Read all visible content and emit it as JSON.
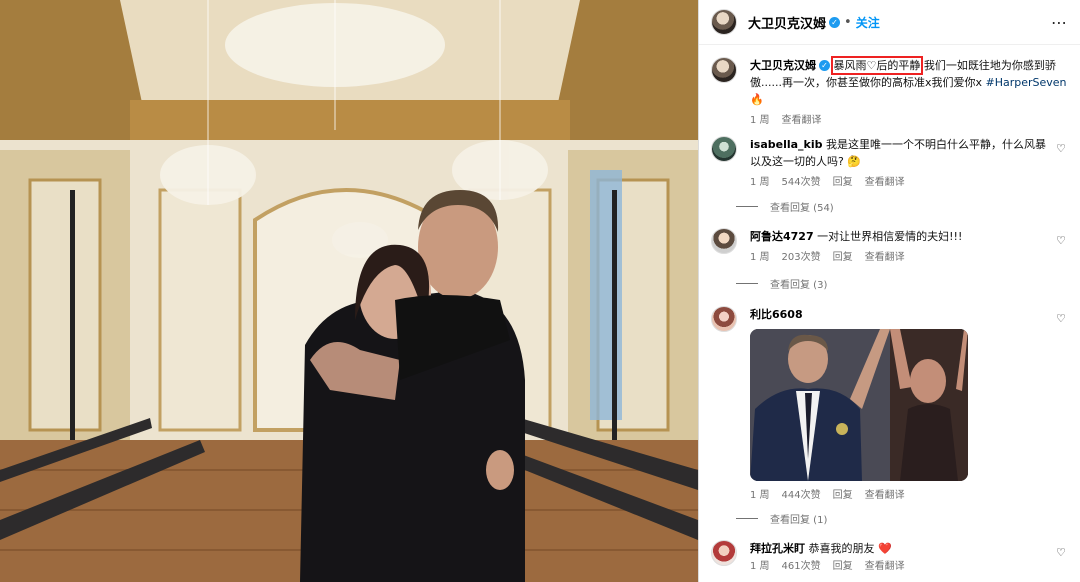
{
  "header": {
    "username": "大卫贝克汉姆",
    "dot": "•",
    "follow_label": "关注",
    "more_label": "⋯"
  },
  "caption": {
    "username": "大卫贝克汉姆",
    "text_highlight": "暴风雨♡后的平静",
    "text_rest": "  我们一如既往地为你感到骄傲......再一次，你甚至做你的高标准x我们爱你x ",
    "hashtag": "#HarperSeven",
    "emoji": "🔥",
    "time": "1 周",
    "translate": "查看翻译"
  },
  "comments": [
    {
      "username": "isabella_kib",
      "text": "我是这里唯一一个不明白什么平静，什么风暴以及这一切的人吗? 🤔",
      "time": "1 周",
      "likes": "544次赞",
      "reply": "回复",
      "translate": "查看翻译",
      "view_replies": "查看回复 (54)"
    },
    {
      "username": "阿鲁达4727",
      "text": "一对让世界相信爱情的夫妇!!!",
      "time": "1 周",
      "likes": "203次赞",
      "reply": "回复",
      "translate": "查看翻译",
      "view_replies": "查看回复 (3)"
    },
    {
      "username": "利比6608",
      "text": "",
      "time": "1 周",
      "likes": "444次赞",
      "reply": "回复",
      "translate": "查看翻译",
      "view_replies": "查看回复 (1)"
    },
    {
      "username": "拜拉孔米盯",
      "text": "恭喜我的朋友",
      "emoji": "❤️",
      "time": "1 周",
      "likes": "461次赞",
      "reply": "回复",
      "translate": "查看翻译"
    }
  ],
  "icons": {
    "heart": "♡",
    "verified": "✓"
  },
  "colors": {
    "link": "#0095f6",
    "hashtag": "#00376b",
    "highlight_box": "#e22222",
    "verified": "#1d9bf0"
  }
}
